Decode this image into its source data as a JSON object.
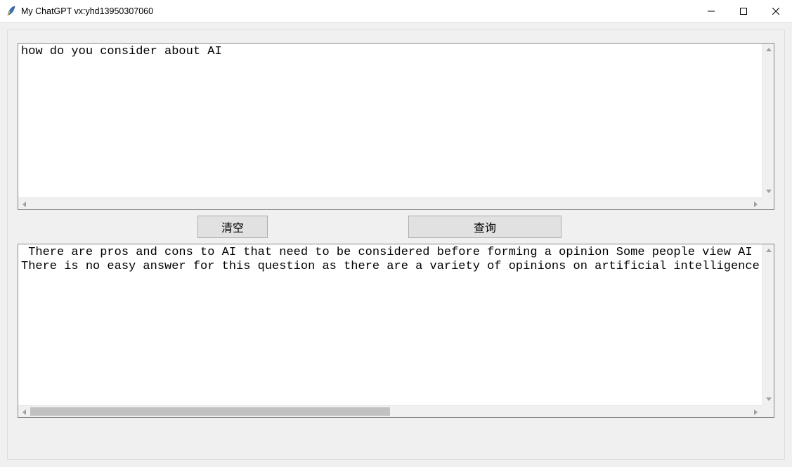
{
  "window": {
    "title": "My ChatGPT vx:yhd13950307060"
  },
  "input": {
    "text": "how do you consider about AI"
  },
  "buttons": {
    "clear_label": "清空",
    "query_label": "查询"
  },
  "output": {
    "text": " There are pros and cons to AI that need to be considered before forming a opinion Some people view AI\nThere is no easy answer for this question as there are a variety of opinions on artificial intelligence"
  }
}
